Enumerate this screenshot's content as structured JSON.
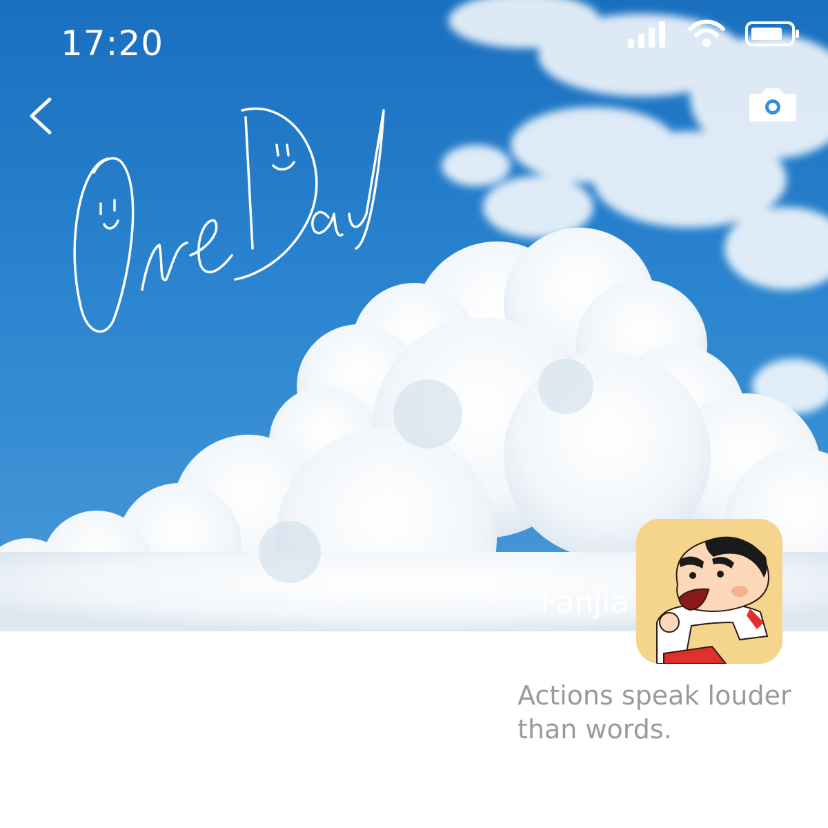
{
  "status_bar": {
    "time": "17:20",
    "icons": [
      "signal-icon",
      "wifi-icon",
      "battery-icon"
    ]
  },
  "header": {
    "back_icon": "chevron-left-icon",
    "camera_icon": "camera-icon"
  },
  "cover": {
    "handwritten_text": "One Day",
    "sky_color": "#1a6fbf"
  },
  "profile": {
    "name": "Fanjia",
    "avatar_icon": "cartoon-avatar",
    "motto": "Actions speak louder than words."
  }
}
